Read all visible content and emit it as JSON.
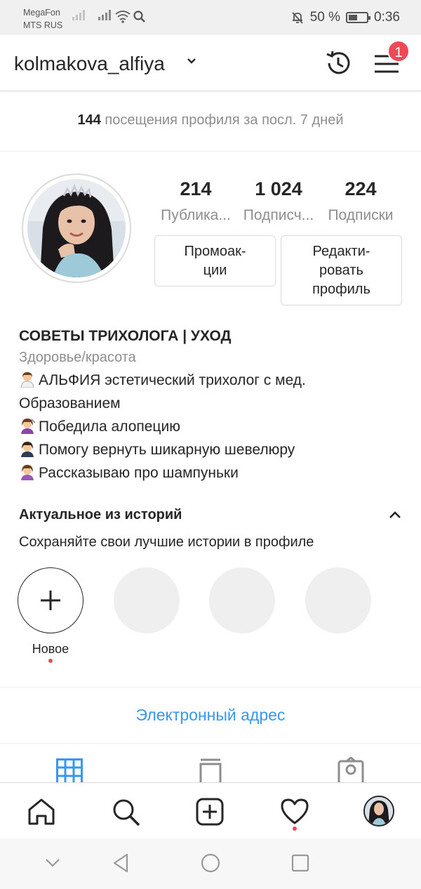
{
  "status_bar": {
    "carrier1": "MegaFon",
    "carrier2": "MTS RUS",
    "battery_pct": "50 %",
    "battery_level": 0.5,
    "time": "0:36"
  },
  "header": {
    "username": "kolmakova_alfiya",
    "notifications_count": "1"
  },
  "insights": {
    "visits_count": "144",
    "visits_text": " посещения профиля за посл. 7 дней"
  },
  "stats": [
    {
      "value": "214",
      "label": "Публика..."
    },
    {
      "value": "1 024",
      "label": "Подписч..."
    },
    {
      "value": "224",
      "label": "Подписки"
    }
  ],
  "buttons": {
    "promotions_line1": "Промоак-",
    "promotions_line2": "ции",
    "edit_line1": "Редакти-",
    "edit_line2": "ровать",
    "edit_line3": "профиль"
  },
  "bio": {
    "name": "СОВЕТЫ ТРИХОЛОГА | УХОД",
    "category": "Здоровье/красота",
    "lines": [
      "АЛЬФИЯ эстетический трихолог с мед.",
      "Образованием",
      "Победила алопецию",
      "Помогу вернуть шикарную шевелюру",
      "Рассказываю про шампуньки"
    ]
  },
  "highlights": {
    "title": "Актуальное из историй",
    "subtitle": "Сохраняйте свои лучшие истории в профиле",
    "new_label": "Новое"
  },
  "contact": {
    "email_label": "Электронный адрес"
  },
  "colors": {
    "accent_blue": "#3897f0",
    "badge_red": "#ed4956",
    "text_primary": "#262626",
    "text_secondary": "#8e8e8e"
  },
  "icons": {
    "tab_grid": "grid-icon",
    "tab_feed": "feed-icon",
    "tab_tagged": "tagged-icon",
    "nav_home": "home-icon",
    "nav_search": "search-icon",
    "nav_add": "add-post-icon",
    "nav_activity": "heart-icon",
    "nav_profile": "profile-avatar"
  }
}
